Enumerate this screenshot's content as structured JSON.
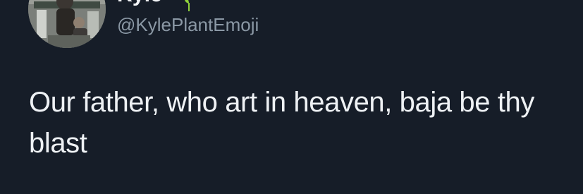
{
  "tweet": {
    "author": {
      "display_name": "Kyle",
      "display_name_emoji": "plant-emoji",
      "handle": "@KylePlantEmoji",
      "avatar_icon": "avatar-photo"
    },
    "text": "Our father, who art in heaven, baja be thy blast"
  },
  "colors": {
    "background": "#161d28",
    "text_primary": "#eef1f4",
    "text_secondary": "#8b98a5",
    "emoji_green": "#8fd13a"
  }
}
